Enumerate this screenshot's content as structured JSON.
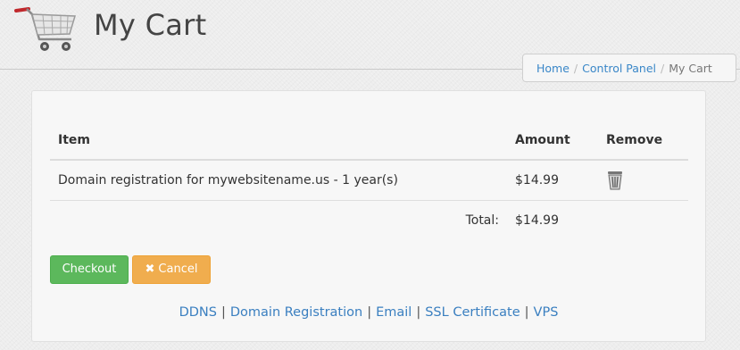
{
  "header": {
    "title": "My Cart"
  },
  "breadcrumb": {
    "home": "Home",
    "control_panel": "Control Panel",
    "current": "My Cart"
  },
  "table": {
    "headers": {
      "item": "Item",
      "amount": "Amount",
      "remove": "Remove"
    },
    "rows": [
      {
        "item": "Domain registration for mywebsitename.us - 1 year(s)",
        "amount": "$14.99"
      }
    ],
    "total_label": "Total:",
    "total_value": "$14.99"
  },
  "buttons": {
    "checkout": "Checkout",
    "cancel": "Cancel",
    "cancel_icon": "close-icon"
  },
  "footer": {
    "links": [
      "DDNS",
      "Domain Registration",
      "Email",
      "SSL Certificate",
      "VPS"
    ]
  },
  "colors": {
    "checkout": "#5cb85c",
    "cancel": "#f0ad4e",
    "link": "#3a7fc0"
  }
}
